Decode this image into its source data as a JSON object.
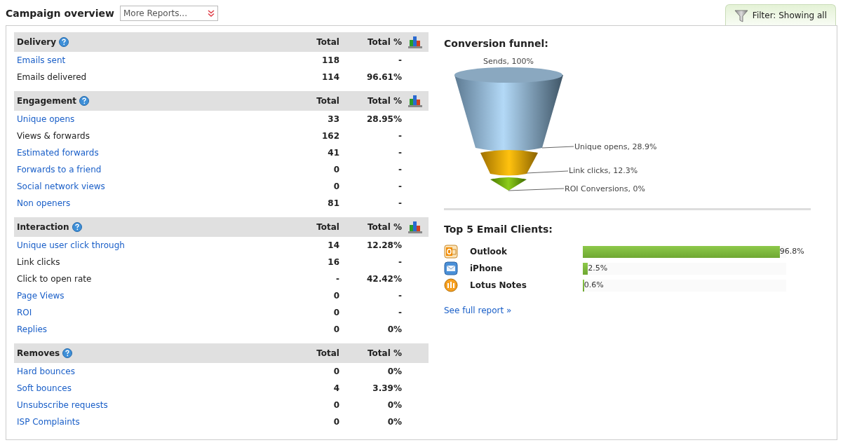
{
  "page_title": "Campaign overview",
  "reports_dropdown": {
    "value": "More Reports..."
  },
  "filter_tab": {
    "label": "Filter: Showing all"
  },
  "sections": [
    {
      "title": "Delivery",
      "col_total": "Total",
      "col_percent": "Total %",
      "chart_icon": true,
      "rows": [
        {
          "kind": "link",
          "label": "Emails sent",
          "total": "118",
          "percent": "-"
        },
        {
          "kind": "text",
          "label": "Emails delivered",
          "total": "114",
          "percent": "96.61%"
        }
      ]
    },
    {
      "title": "Engagement",
      "col_total": "Total",
      "col_percent": "Total %",
      "chart_icon": true,
      "rows": [
        {
          "kind": "link",
          "label": "Unique opens",
          "total": "33",
          "percent": "28.95%"
        },
        {
          "kind": "text",
          "label": "Views & forwards",
          "total": "162",
          "percent": "-"
        },
        {
          "kind": "link",
          "label": "Estimated forwards",
          "total": "41",
          "percent": "-"
        },
        {
          "kind": "link",
          "label": "Forwards to a friend",
          "total": "0",
          "percent": "-"
        },
        {
          "kind": "link",
          "label": "Social network views",
          "total": "0",
          "percent": "-"
        },
        {
          "kind": "link",
          "label": "Non openers",
          "total": "81",
          "percent": "-"
        }
      ]
    },
    {
      "title": "Interaction",
      "col_total": "Total",
      "col_percent": "Total %",
      "chart_icon": true,
      "rows": [
        {
          "kind": "link",
          "label": "Unique user click through",
          "total": "14",
          "percent": "12.28%"
        },
        {
          "kind": "text",
          "label": "Link clicks",
          "total": "16",
          "percent": "-"
        },
        {
          "kind": "text",
          "label": "Click to open rate",
          "total": "-",
          "percent": "42.42%"
        },
        {
          "kind": "link",
          "label": "Page Views",
          "total": "0",
          "percent": "-"
        },
        {
          "kind": "link",
          "label": "ROI",
          "total": "0",
          "percent": "-"
        },
        {
          "kind": "link",
          "label": "Replies",
          "total": "0",
          "percent": "0%"
        }
      ]
    },
    {
      "title": "Removes",
      "col_total": "Total",
      "col_percent": "Total %",
      "chart_icon": false,
      "rows": [
        {
          "kind": "link",
          "label": "Hard bounces",
          "total": "0",
          "percent": "0%"
        },
        {
          "kind": "link",
          "label": "Soft bounces",
          "total": "4",
          "percent": "3.39%"
        },
        {
          "kind": "link",
          "label": "Unsubscribe requests",
          "total": "0",
          "percent": "0%"
        },
        {
          "kind": "link",
          "label": "ISP Complaints",
          "total": "0",
          "percent": "0%"
        }
      ]
    }
  ],
  "conversion_funnel": {
    "title": "Conversion funnel:",
    "labels": [
      "Sends, 100%",
      "Unique opens, 28.9%",
      "Link clicks, 12.3%",
      "ROI Conversions, 0%"
    ]
  },
  "email_clients": {
    "title": "Top 5 Email Clients:",
    "clients": [
      {
        "kind": "outlook",
        "name": "Outlook",
        "level": 0.968,
        "reading": "96.8%"
      },
      {
        "kind": "iphone",
        "name": "iPhone",
        "level": 0.025,
        "reading": "2.5%"
      },
      {
        "kind": "lotus",
        "name": "Lotus Notes",
        "level": 0.006,
        "reading": "0.6%"
      }
    ],
    "link": "See full report »"
  }
}
